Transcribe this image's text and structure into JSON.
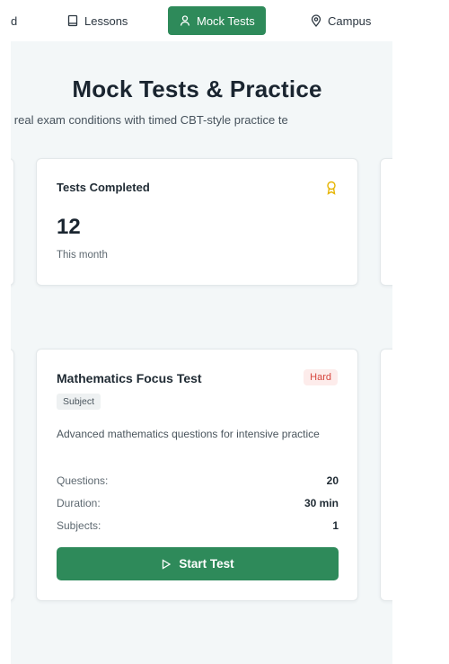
{
  "nav": {
    "items": [
      {
        "label": "d",
        "icon": "none"
      },
      {
        "label": "Lessons",
        "icon": "book-icon"
      },
      {
        "label": "Mock Tests",
        "icon": "user-icon",
        "active": true
      },
      {
        "label": "Campus",
        "icon": "map-pin-icon"
      }
    ]
  },
  "page": {
    "title": "Mock Tests & Practice",
    "subtitle": "ulate real exam conditions with timed CBT-style practice te"
  },
  "stat": {
    "title": "Tests Completed",
    "icon": "award-icon",
    "value": "12",
    "caption": "This month"
  },
  "test": {
    "title": "Mathematics Focus Test",
    "difficulty": "Hard",
    "type": "Subject",
    "description": "Advanced mathematics questions for intensive practice",
    "meta": [
      {
        "label": "Questions:",
        "value": "20"
      },
      {
        "label": "Duration:",
        "value": "30 min"
      },
      {
        "label": "Subjects:",
        "value": "1"
      }
    ],
    "button_label": "Start Test",
    "button_icon": "play-icon"
  },
  "colors": {
    "accent": "#2e8a5a",
    "page_bg": "#f3f7f8",
    "badge_hard_bg": "#fdeceb",
    "badge_hard_text": "#d6453d",
    "award_icon": "#e6b400"
  }
}
